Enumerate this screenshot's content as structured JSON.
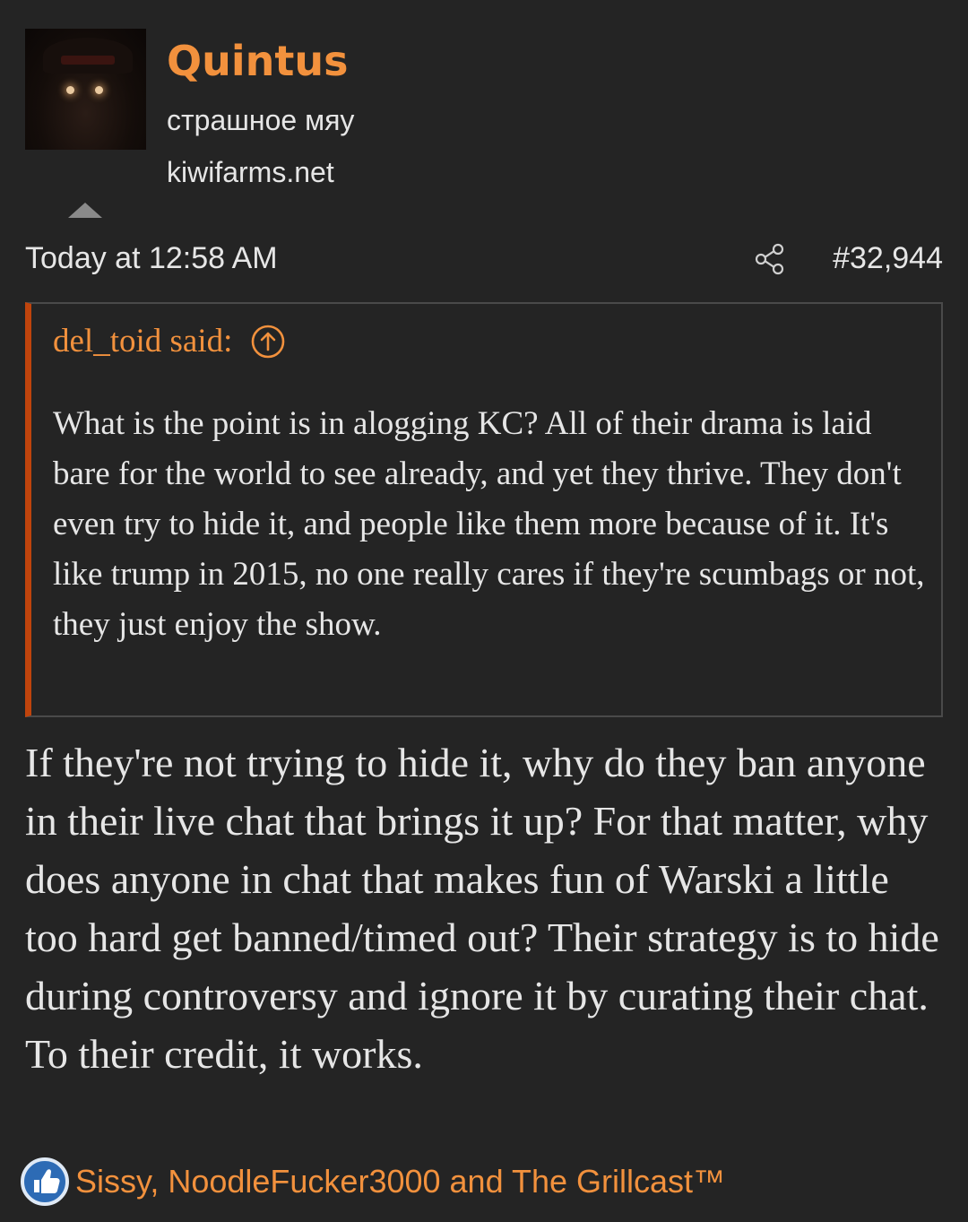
{
  "colors": {
    "background": "#242424",
    "accent_orange": "#f2913d",
    "quote_bar": "#c0440c",
    "text": "#e6e6e6",
    "border": "#4a4a4a",
    "like_blue": "#2d6bb5"
  },
  "user": {
    "avatar_icon": "avatar-image",
    "name": "Quintus",
    "title": "страшное мяу",
    "banner": "kiwifarms.net"
  },
  "meta": {
    "timestamp": "Today at 12:58 AM",
    "share_icon": "share-icon",
    "post_number": "#32,944"
  },
  "quote": {
    "author_label": "del_toid said:",
    "jump_icon": "arrow-up-circle-icon",
    "text": "What is the point is in alogging KC? All of their drama is laid bare for the world to see already, and yet they thrive. They don't even try to hide it, and people like them more because of it. It's like trump in 2015, no one really cares if they're scumbags or not, they just enjoy the show."
  },
  "post": {
    "body": "If they're not trying to hide it, why do they ban anyone in their live chat that brings it up? For that matter, why does anyone in chat that makes fun of Warski a little too hard get banned/timed out? Their strategy is to hide during controversy and ignore it by curating their chat. To their credit, it works."
  },
  "reactions": {
    "icon": "like-icon",
    "users": "Sissy, NoodleFucker3000 and The Grillcast™"
  }
}
